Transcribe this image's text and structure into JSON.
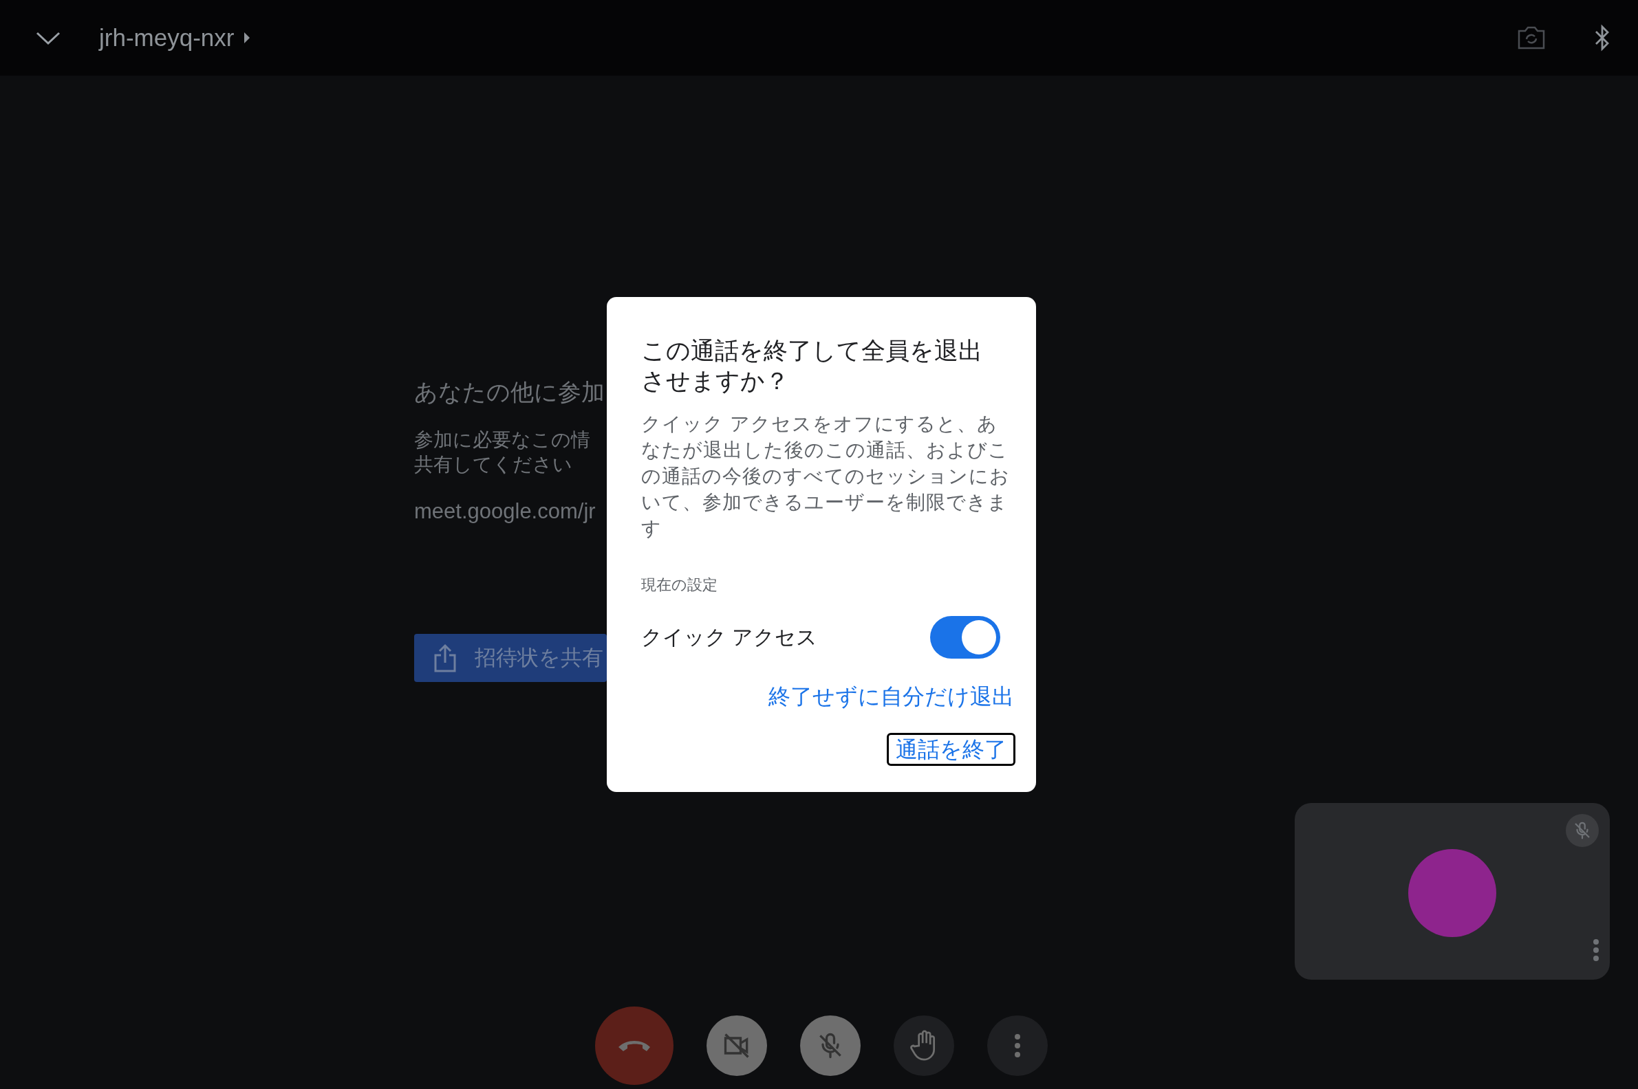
{
  "top_bar": {
    "meeting_code": "jrh-meyq-nxr"
  },
  "invite_panel": {
    "heading": "あなたの他に参加",
    "info_lines": [
      "参加に必要なこの情",
      "共有してください"
    ],
    "link": "meet.google.com/jr",
    "share_button": "招待状を共有"
  },
  "dialog": {
    "title": "この通話を終了して全員を退出させますか？",
    "body": "クイック アクセスをオフにすると、あなたが退出した後のこの通話、およびこの通話の今後のすべてのセッションにおいて、参加できるユーザーを制限できます",
    "section_label": "現在の設定",
    "setting": {
      "label": "クイック アクセス",
      "on": true
    },
    "link": "終了せずに自分だけ退出",
    "button": "通話を終了"
  },
  "self_view": {
    "muted": true
  },
  "controls": [
    {
      "kind": "end-call"
    },
    {
      "kind": "camera",
      "on": false
    },
    {
      "kind": "mic",
      "on": false
    },
    {
      "kind": "hand"
    },
    {
      "kind": "more"
    }
  ]
}
